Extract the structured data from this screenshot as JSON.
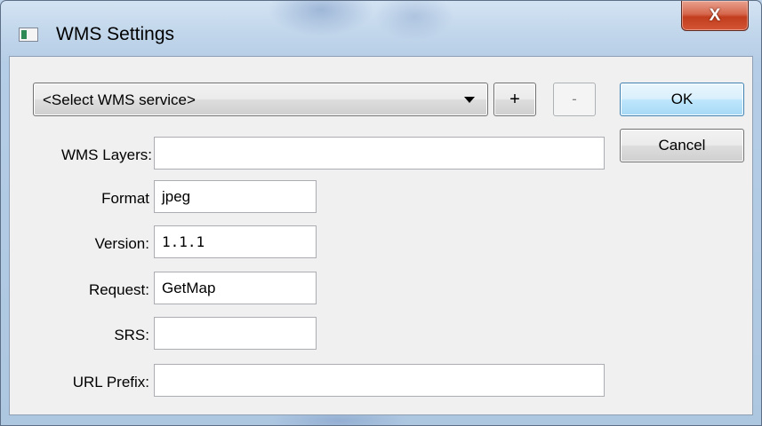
{
  "window": {
    "title": "WMS Settings",
    "close_glyph": "X"
  },
  "service_select": {
    "selected": "<Select WMS service>"
  },
  "buttons": {
    "add_label": "+",
    "remove_label": "-",
    "ok_label": "OK",
    "cancel_label": "Cancel"
  },
  "fields": {
    "wms_layers": {
      "label": "WMS Layers:",
      "value": ""
    },
    "format": {
      "label": "Format",
      "value": "jpeg"
    },
    "version": {
      "label": "Version:",
      "value": "1.1.1"
    },
    "request": {
      "label": "Request:",
      "value": "GetMap"
    },
    "srs": {
      "label": "SRS:",
      "value": ""
    },
    "url_prefix": {
      "label": "URL Prefix:",
      "value": ""
    }
  },
  "icons": {
    "app": "app-window-icon",
    "close": "close-icon",
    "dropdown": "chevron-down-icon"
  }
}
